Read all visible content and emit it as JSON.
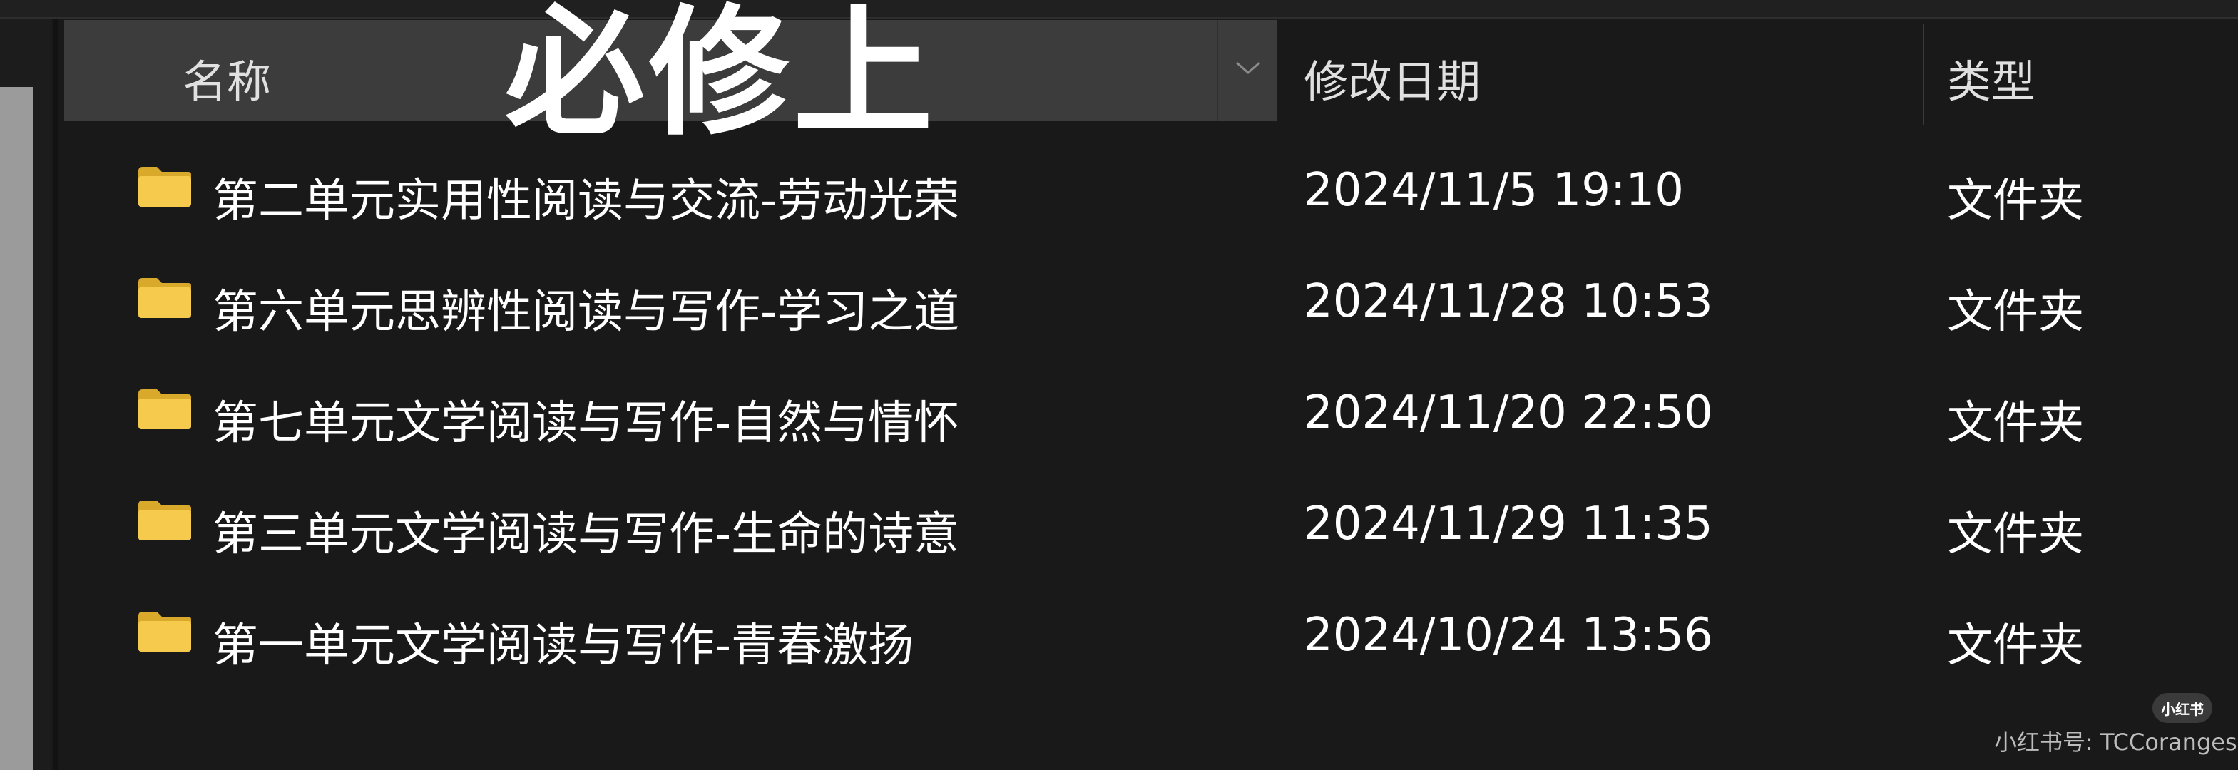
{
  "header": {
    "name_label": "名称",
    "date_label": "修改日期",
    "type_label": "类型",
    "sort_icon": "chevron-down-icon"
  },
  "overlay": {
    "title": "必修上"
  },
  "rows": [
    {
      "name": "第二单元实用性阅读与交流-劳动光荣",
      "date": "2024/11/5 19:10",
      "type": "文件夹",
      "icon": "folder-icon"
    },
    {
      "name": "第六单元思辨性阅读与写作-学习之道",
      "date": "2024/11/28 10:53",
      "type": "文件夹",
      "icon": "folder-icon"
    },
    {
      "name": "第七单元文学阅读与写作-自然与情怀",
      "date": "2024/11/20 22:50",
      "type": "文件夹",
      "icon": "folder-icon"
    },
    {
      "name": "第三单元文学阅读与写作-生命的诗意",
      "date": "2024/11/29 11:35",
      "type": "文件夹",
      "icon": "folder-icon"
    },
    {
      "name": "第一单元文学阅读与写作-青春激扬",
      "date": "2024/10/24 13:56",
      "type": "文件夹",
      "icon": "folder-icon"
    }
  ],
  "watermark": {
    "badge": "小红书",
    "text": "小红书号: TCCoranges"
  },
  "colors": {
    "background": "#191919",
    "header_bg": "#3c3c3c",
    "folder": "#f4c84a",
    "text": "#ffffff"
  }
}
